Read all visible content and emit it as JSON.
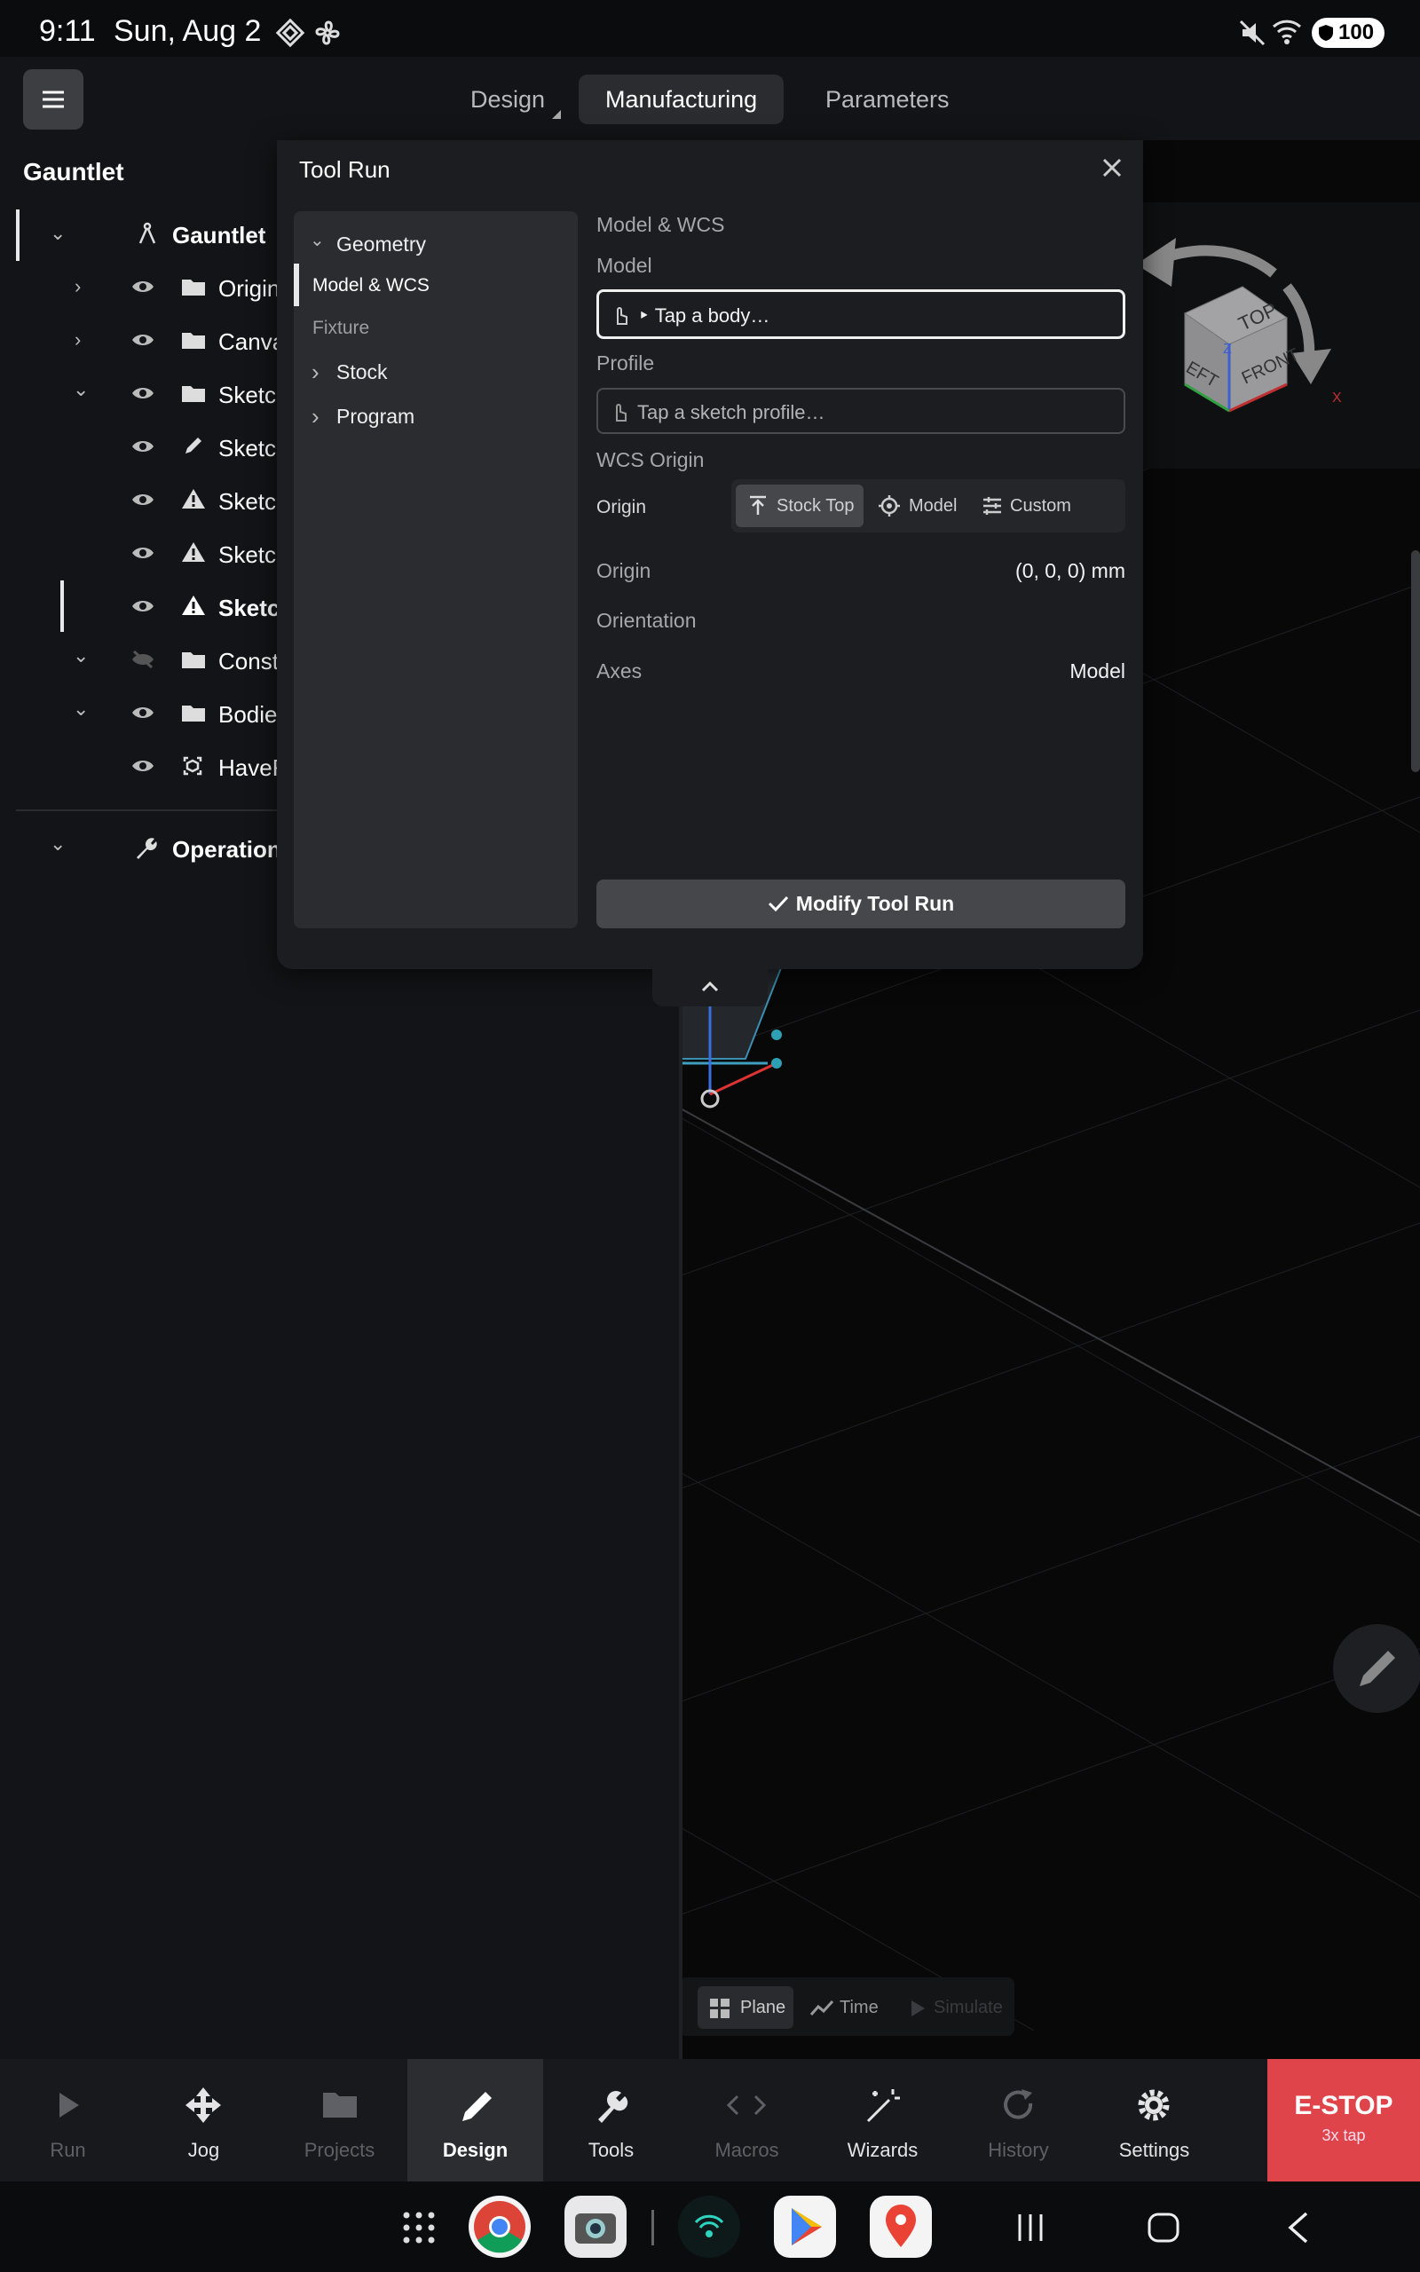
{
  "status": {
    "time": "9:11",
    "date": "Sun, Aug 2",
    "battery": "100"
  },
  "topbar": {
    "tabs": [
      {
        "label": "Design"
      },
      {
        "label": "Manufacturing"
      },
      {
        "label": "Parameters"
      }
    ]
  },
  "tree": {
    "title": "Gauntlet",
    "items": [
      {
        "label": "Gauntlet"
      },
      {
        "label": "Origin"
      },
      {
        "label": "Canva"
      },
      {
        "label": "Sketc"
      },
      {
        "label": "Sketcl"
      },
      {
        "label": "Sketcl"
      },
      {
        "label": "Sketcl"
      },
      {
        "label": "Sketcl"
      },
      {
        "label": "Const"
      },
      {
        "label": "Bodie"
      },
      {
        "label": "HaveF"
      },
      {
        "label": "Operations"
      }
    ]
  },
  "panel": {
    "title": "Tool Run",
    "nav": {
      "geometry": "Geometry",
      "model_wcs": "Model & WCS",
      "fixture": "Fixture",
      "stock": "Stock",
      "program": "Program"
    },
    "section_title": "Model & WCS",
    "model_label": "Model",
    "model_placeholder": "‣ Tap a body…",
    "profile_label": "Profile",
    "profile_placeholder": "Tap a sketch profile…",
    "wcs_origin_label": "WCS Origin",
    "origin_label": "Origin",
    "origin_options": [
      {
        "label": "Stock Top"
      },
      {
        "label": "Model"
      },
      {
        "label": "Custom"
      }
    ],
    "origin_row_label": "Origin",
    "origin_value": "(0, 0, 0) mm",
    "orientation_label": "Orientation",
    "axes_label": "Axes",
    "axes_value": "Model",
    "modify_button": "Modify Tool Run"
  },
  "viewcube": {
    "top": "TOP",
    "front": "FRONT",
    "left": "EFT",
    "z": "Z",
    "x": "X"
  },
  "viewport_toolbar": {
    "plane": "Plane",
    "time": "Time",
    "simulate": "Simulate"
  },
  "bottomnav": {
    "items": [
      {
        "label": "Run"
      },
      {
        "label": "Jog"
      },
      {
        "label": "Projects"
      },
      {
        "label": "Design"
      },
      {
        "label": "Tools"
      },
      {
        "label": "Macros"
      },
      {
        "label": "Wizards"
      },
      {
        "label": "History"
      },
      {
        "label": "Settings"
      }
    ],
    "estop": "E-STOP",
    "estop_hint": "3x tap"
  },
  "colors": {
    "accent_estop": "#e0444b",
    "panel_bg": "#1c1d20",
    "nav_bg": "#2b2c30",
    "cube_face": "#9a9a9d"
  }
}
